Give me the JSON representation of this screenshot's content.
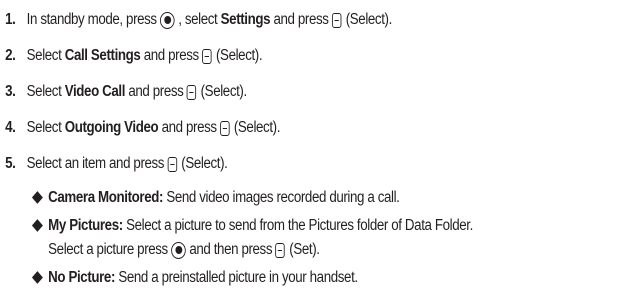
{
  "steps": [
    {
      "number": "1.",
      "pre": "In standby mode, press",
      "mid": ", select",
      "bold": "Settings",
      "post": "and press",
      "end": "(Select)."
    },
    {
      "number": "2.",
      "pre": "Select",
      "bold": "Call Settings",
      "post": "and press",
      "end": "(Select)."
    },
    {
      "number": "3.",
      "pre": "Select",
      "bold": "Video Call",
      "post": "and press",
      "end": "(Select)."
    },
    {
      "number": "4.",
      "pre": "Select",
      "bold": "Outgoing Video",
      "post": "and press",
      "end": "(Select)."
    },
    {
      "number": "5.",
      "pre": "Select an item and press",
      "end": "(Select)."
    }
  ],
  "options": [
    {
      "term": "Camera Monitored:",
      "desc": "Send video images recorded during a call."
    },
    {
      "term": "My Pictures:",
      "desc": "Select a picture to send from the Pictures folder of Data Folder.",
      "cont_pre": "Select a picture press",
      "cont_mid": "and then press",
      "cont_end": "(Set)."
    },
    {
      "term": "No Picture:",
      "desc": "Send a preinstalled picture in your handset."
    }
  ],
  "icons": {
    "nav_key": "navigation-key-icon",
    "soft_key": "soft-key-icon"
  }
}
